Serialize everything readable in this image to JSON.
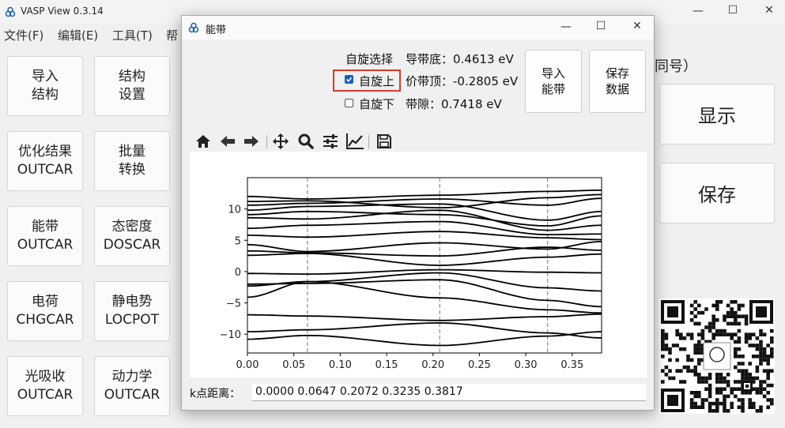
{
  "main_window": {
    "title": "VASP View 0.3.14",
    "menu": [
      "文件(F)",
      "编辑(E)",
      "工具(T)",
      "帮"
    ],
    "partial_label": "同号）",
    "tiles": [
      {
        "line1": "导入",
        "line2": "结构"
      },
      {
        "line1": "结构",
        "line2": "设置"
      },
      {
        "line1": "优化结果",
        "line2": "OUTCAR"
      },
      {
        "line1": "批量",
        "line2": "转换"
      },
      {
        "line1": "能带",
        "line2": "OUTCAR"
      },
      {
        "line1": "态密度",
        "line2": "DOSCAR"
      },
      {
        "line1": "电荷",
        "line2": "CHGCAR"
      },
      {
        "line1": "静电势",
        "line2": "LOCPOT"
      },
      {
        "line1": "光吸收",
        "line2": "OUTCAR"
      },
      {
        "line1": "动力学",
        "line2": "OUTCAR"
      }
    ],
    "show_button": "显示",
    "save_button": "保存"
  },
  "dialog": {
    "title": "能带",
    "spin_select_label": "自旋选择",
    "spin_up_label": "自旋上",
    "spin_down_label": "自旋下",
    "spin_up_checked": true,
    "spin_down_checked": false,
    "cbm_text": "导带底：0.4613 eV",
    "vbm_text": "价带顶：-0.2805 eV",
    "gap_text": "带隙：0.7418 eV",
    "import_btn": {
      "line1": "导入",
      "line2": "能带"
    },
    "save_btn": {
      "line1": "保存",
      "line2": "数据"
    },
    "toolbar": [
      "home-icon",
      "back-icon",
      "forward-icon",
      "pan-icon",
      "zoom-icon",
      "configure-icon",
      "edit-axes-icon",
      "save-figure-icon"
    ],
    "kdist_label": "k点距离：",
    "kdist_value": "0.0000 0.0647 0.2072 0.3235 0.3817"
  },
  "chart_data": {
    "type": "line",
    "xlim": [
      0.0,
      0.3817
    ],
    "ylim": [
      -13,
      15
    ],
    "xticks": [
      "0.00",
      "0.05",
      "0.10",
      "0.15",
      "0.20",
      "0.25",
      "0.30",
      "0.35"
    ],
    "xtick_values": [
      0.0,
      0.05,
      0.1,
      0.15,
      0.2,
      0.25,
      0.3,
      0.35
    ],
    "yticks": [
      "−10",
      "−5",
      "0",
      "5",
      "10"
    ],
    "ytick_values": [
      -10,
      -5,
      0,
      5,
      10
    ],
    "kpath_lines": [
      0.0647,
      0.2072,
      0.3235
    ],
    "grid": false,
    "line_color": "#000000",
    "kpoints": [
      0.0,
      0.0647,
      0.2072,
      0.3235,
      0.3817
    ],
    "bands": [
      [
        -10.8,
        -10.2,
        -11.8,
        -10.3,
        -9.6
      ],
      [
        -9.6,
        -9.3,
        -8.2,
        -9.8,
        -10.6
      ],
      [
        -6.9,
        -7.1,
        -7.8,
        -7.2,
        -6.8
      ],
      [
        -4.1,
        -1.6,
        -4.2,
        -6.1,
        -6.6
      ],
      [
        -2.3,
        -1.6,
        -0.2,
        -2.6,
        -3.1
      ],
      [
        -2.0,
        -1.9,
        -1.3,
        -4.6,
        -5.6
      ],
      [
        -0.3,
        -0.4,
        0.3,
        -0.1,
        -0.2
      ],
      [
        2.6,
        2.9,
        1.0,
        2.3,
        2.8
      ],
      [
        3.3,
        3.0,
        2.5,
        3.9,
        3.4
      ],
      [
        4.3,
        3.2,
        4.6,
        3.6,
        4.8
      ],
      [
        5.8,
        5.5,
        6.4,
        5.4,
        5.1
      ],
      [
        6.9,
        7.4,
        8.0,
        5.9,
        6.0
      ],
      [
        8.6,
        8.4,
        9.8,
        6.6,
        7.4
      ],
      [
        9.1,
        9.6,
        9.1,
        7.3,
        8.9
      ],
      [
        9.8,
        10.4,
        10.8,
        8.2,
        9.6
      ],
      [
        10.6,
        10.9,
        11.6,
        10.6,
        11.7
      ],
      [
        11.2,
        11.3,
        10.2,
        11.8,
        12.3
      ],
      [
        12.0,
        11.6,
        12.2,
        12.8,
        13.0
      ]
    ]
  }
}
